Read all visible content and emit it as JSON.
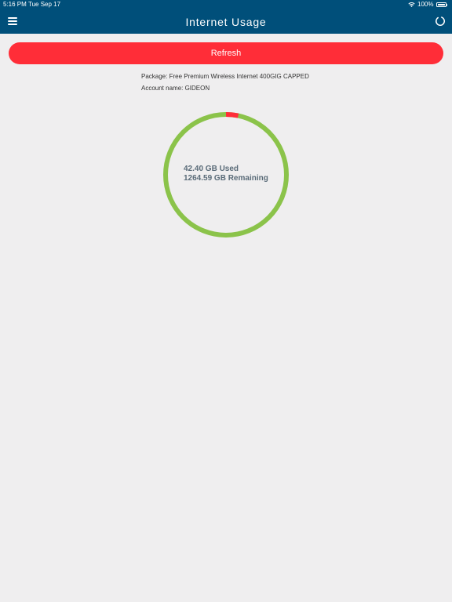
{
  "status_bar": {
    "time": "5:16 PM",
    "date": "Tue Sep 17",
    "battery_percent": "100%",
    "wifi_icon": "wifi-icon",
    "battery_icon": "battery-icon"
  },
  "nav": {
    "title": "Internet Usage",
    "menu_icon": "hamburger-menu-icon",
    "right_icon": "loading-spinner-icon"
  },
  "refresh_label": "Refresh",
  "account": {
    "package": "Package: Free Premium Wireless Internet 400GIG CAPPED",
    "name": "Account name: GIDEON"
  },
  "usage": {
    "used_label": "42.40 GB Used",
    "remaining_label": "1264.59 GB Remaining",
    "used_gb": 42.4,
    "remaining_gb": 1264.59
  },
  "colors": {
    "header": "#004f7a",
    "accent_red": "#ff2d38",
    "ring_used": "#ff2d38",
    "ring_remaining": "#8bc34a",
    "text_muted": "#5a6b78"
  }
}
